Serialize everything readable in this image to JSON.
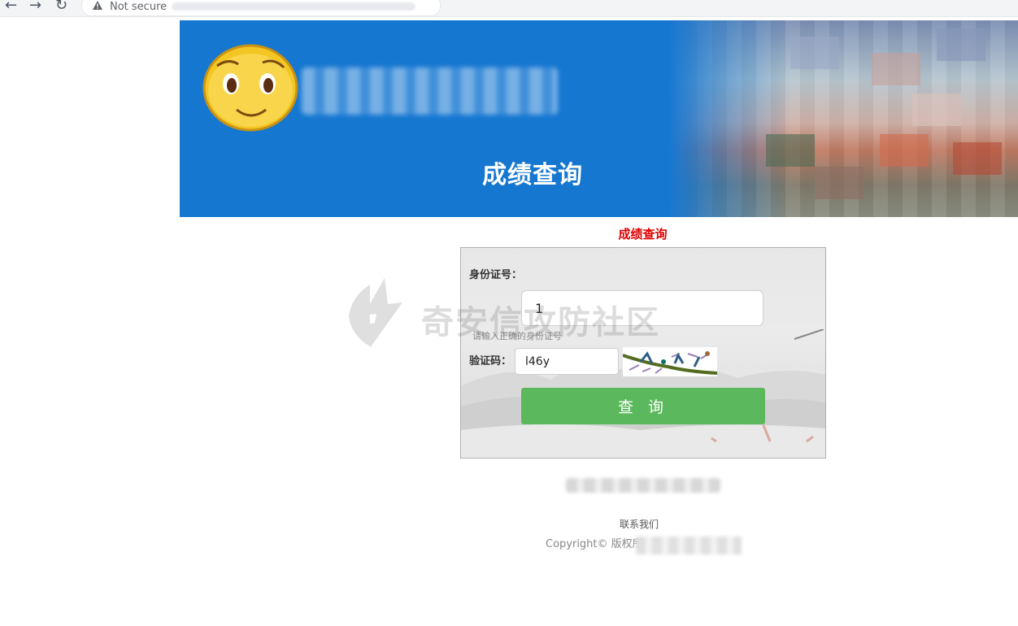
{
  "browser": {
    "security_label": "Not secure"
  },
  "banner": {
    "title": "成绩查询"
  },
  "page_heading": "成绩查询",
  "form": {
    "id_label": "身份证号：",
    "id_value": "1",
    "id_hint": "请输入正确的身份证号",
    "captcha_label": "验证码：",
    "captcha_value": "l46y",
    "submit_label": "查 询"
  },
  "watermark": {
    "text": "奇安信攻防社区"
  },
  "footer": {
    "contact_label": "联系我们",
    "copyright_prefix": "Copyright© 版权所"
  },
  "colors": {
    "banner_blue": "#1677d1",
    "heading_red": "#e00000",
    "button_green": "#5cb85c"
  }
}
